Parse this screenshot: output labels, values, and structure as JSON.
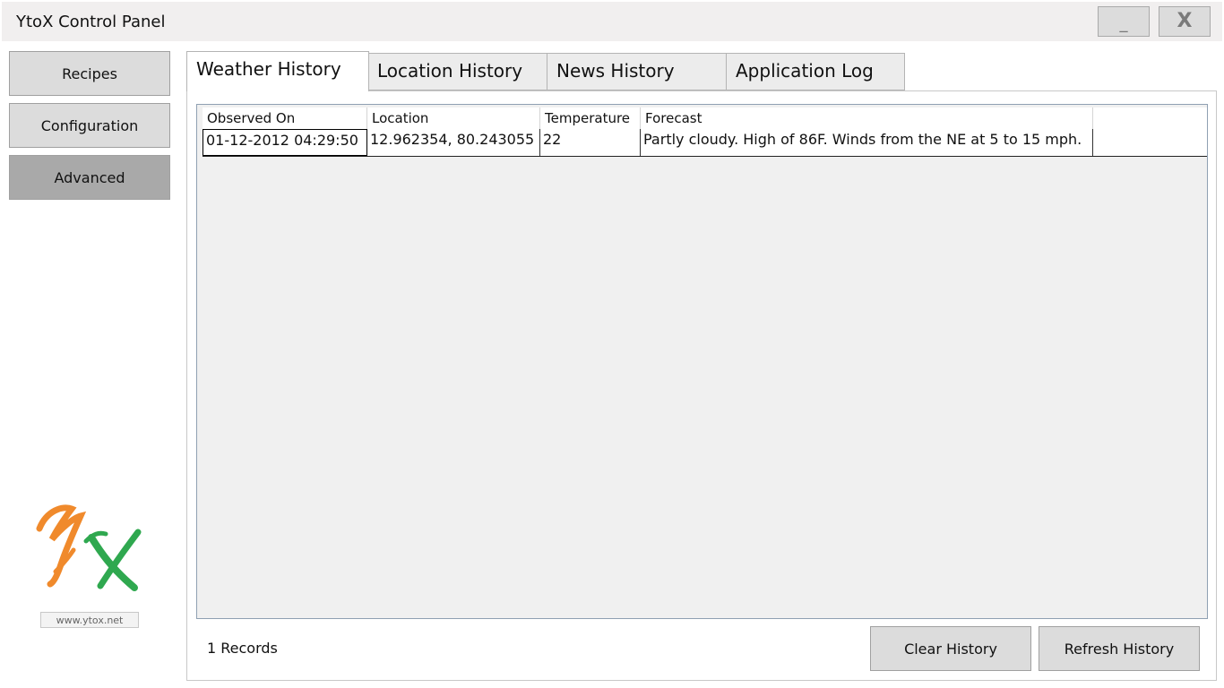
{
  "window": {
    "title": "YtoX Control Panel",
    "minimize_label": "_",
    "close_label": "X"
  },
  "sidebar": {
    "items": [
      {
        "label": "Recipes",
        "active": false
      },
      {
        "label": "Configuration",
        "active": false
      },
      {
        "label": "Advanced",
        "active": true
      }
    ],
    "site_link": "www.ytox.net",
    "logo_colors": {
      "y": "#f08a2c",
      "x": "#2fa84f"
    }
  },
  "tabs": [
    {
      "label": "Weather History",
      "active": true
    },
    {
      "label": "Location History",
      "active": false
    },
    {
      "label": "News History",
      "active": false
    },
    {
      "label": "Application Log",
      "active": false
    }
  ],
  "table": {
    "columns": [
      "Observed On",
      "Location",
      "Temperature",
      "Forecast"
    ],
    "rows": [
      [
        "01-12-2012 04:29:50",
        "12.962354, 80.243055",
        "22",
        "Partly cloudy. High of 86F. Winds from the NE at 5 to 15 mph."
      ]
    ]
  },
  "footer": {
    "records_text": "1 Records",
    "clear_label": "Clear History",
    "refresh_label": "Refresh History"
  }
}
